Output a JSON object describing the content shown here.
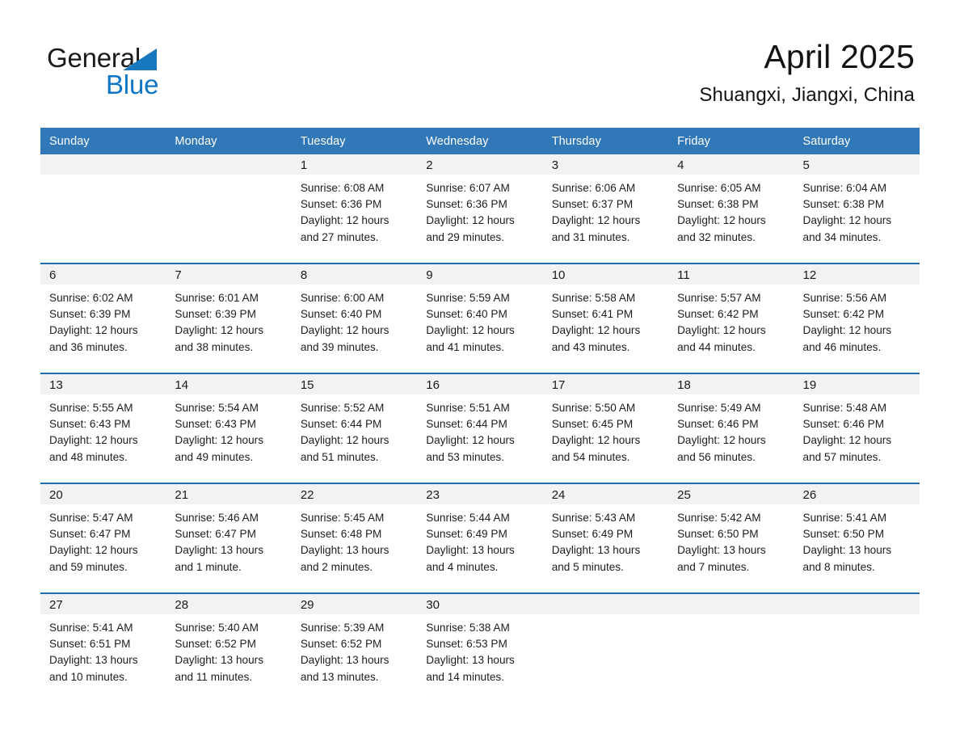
{
  "brand": {
    "name_part1": "General",
    "name_part2": "Blue",
    "triangle_color": "#1878be",
    "blue_color": "#0f76c4"
  },
  "header": {
    "month_title": "April 2025",
    "location": "Shuangxi, Jiangxi, China"
  },
  "theme": {
    "header_blue": "#3178b8",
    "separator_blue": "#1f6eb0",
    "daynum_band": "#f2f2f2",
    "text": "#1d1d1d"
  },
  "calendar": {
    "weekday_headers": [
      "Sunday",
      "Monday",
      "Tuesday",
      "Wednesday",
      "Thursday",
      "Friday",
      "Saturday"
    ],
    "weeks": [
      [
        {
          "day": "",
          "sunrise": "",
          "sunset": "",
          "daylight1": "",
          "daylight2": "",
          "empty": true
        },
        {
          "day": "",
          "sunrise": "",
          "sunset": "",
          "daylight1": "",
          "daylight2": "",
          "empty": true
        },
        {
          "day": "1",
          "sunrise": "Sunrise: 6:08 AM",
          "sunset": "Sunset: 6:36 PM",
          "daylight1": "Daylight: 12 hours",
          "daylight2": "and 27 minutes."
        },
        {
          "day": "2",
          "sunrise": "Sunrise: 6:07 AM",
          "sunset": "Sunset: 6:36 PM",
          "daylight1": "Daylight: 12 hours",
          "daylight2": "and 29 minutes."
        },
        {
          "day": "3",
          "sunrise": "Sunrise: 6:06 AM",
          "sunset": "Sunset: 6:37 PM",
          "daylight1": "Daylight: 12 hours",
          "daylight2": "and 31 minutes."
        },
        {
          "day": "4",
          "sunrise": "Sunrise: 6:05 AM",
          "sunset": "Sunset: 6:38 PM",
          "daylight1": "Daylight: 12 hours",
          "daylight2": "and 32 minutes."
        },
        {
          "day": "5",
          "sunrise": "Sunrise: 6:04 AM",
          "sunset": "Sunset: 6:38 PM",
          "daylight1": "Daylight: 12 hours",
          "daylight2": "and 34 minutes."
        }
      ],
      [
        {
          "day": "6",
          "sunrise": "Sunrise: 6:02 AM",
          "sunset": "Sunset: 6:39 PM",
          "daylight1": "Daylight: 12 hours",
          "daylight2": "and 36 minutes."
        },
        {
          "day": "7",
          "sunrise": "Sunrise: 6:01 AM",
          "sunset": "Sunset: 6:39 PM",
          "daylight1": "Daylight: 12 hours",
          "daylight2": "and 38 minutes."
        },
        {
          "day": "8",
          "sunrise": "Sunrise: 6:00 AM",
          "sunset": "Sunset: 6:40 PM",
          "daylight1": "Daylight: 12 hours",
          "daylight2": "and 39 minutes."
        },
        {
          "day": "9",
          "sunrise": "Sunrise: 5:59 AM",
          "sunset": "Sunset: 6:40 PM",
          "daylight1": "Daylight: 12 hours",
          "daylight2": "and 41 minutes."
        },
        {
          "day": "10",
          "sunrise": "Sunrise: 5:58 AM",
          "sunset": "Sunset: 6:41 PM",
          "daylight1": "Daylight: 12 hours",
          "daylight2": "and 43 minutes."
        },
        {
          "day": "11",
          "sunrise": "Sunrise: 5:57 AM",
          "sunset": "Sunset: 6:42 PM",
          "daylight1": "Daylight: 12 hours",
          "daylight2": "and 44 minutes."
        },
        {
          "day": "12",
          "sunrise": "Sunrise: 5:56 AM",
          "sunset": "Sunset: 6:42 PM",
          "daylight1": "Daylight: 12 hours",
          "daylight2": "and 46 minutes."
        }
      ],
      [
        {
          "day": "13",
          "sunrise": "Sunrise: 5:55 AM",
          "sunset": "Sunset: 6:43 PM",
          "daylight1": "Daylight: 12 hours",
          "daylight2": "and 48 minutes."
        },
        {
          "day": "14",
          "sunrise": "Sunrise: 5:54 AM",
          "sunset": "Sunset: 6:43 PM",
          "daylight1": "Daylight: 12 hours",
          "daylight2": "and 49 minutes."
        },
        {
          "day": "15",
          "sunrise": "Sunrise: 5:52 AM",
          "sunset": "Sunset: 6:44 PM",
          "daylight1": "Daylight: 12 hours",
          "daylight2": "and 51 minutes."
        },
        {
          "day": "16",
          "sunrise": "Sunrise: 5:51 AM",
          "sunset": "Sunset: 6:44 PM",
          "daylight1": "Daylight: 12 hours",
          "daylight2": "and 53 minutes."
        },
        {
          "day": "17",
          "sunrise": "Sunrise: 5:50 AM",
          "sunset": "Sunset: 6:45 PM",
          "daylight1": "Daylight: 12 hours",
          "daylight2": "and 54 minutes."
        },
        {
          "day": "18",
          "sunrise": "Sunrise: 5:49 AM",
          "sunset": "Sunset: 6:46 PM",
          "daylight1": "Daylight: 12 hours",
          "daylight2": "and 56 minutes."
        },
        {
          "day": "19",
          "sunrise": "Sunrise: 5:48 AM",
          "sunset": "Sunset: 6:46 PM",
          "daylight1": "Daylight: 12 hours",
          "daylight2": "and 57 minutes."
        }
      ],
      [
        {
          "day": "20",
          "sunrise": "Sunrise: 5:47 AM",
          "sunset": "Sunset: 6:47 PM",
          "daylight1": "Daylight: 12 hours",
          "daylight2": "and 59 minutes."
        },
        {
          "day": "21",
          "sunrise": "Sunrise: 5:46 AM",
          "sunset": "Sunset: 6:47 PM",
          "daylight1": "Daylight: 13 hours",
          "daylight2": "and 1 minute."
        },
        {
          "day": "22",
          "sunrise": "Sunrise: 5:45 AM",
          "sunset": "Sunset: 6:48 PM",
          "daylight1": "Daylight: 13 hours",
          "daylight2": "and 2 minutes."
        },
        {
          "day": "23",
          "sunrise": "Sunrise: 5:44 AM",
          "sunset": "Sunset: 6:49 PM",
          "daylight1": "Daylight: 13 hours",
          "daylight2": "and 4 minutes."
        },
        {
          "day": "24",
          "sunrise": "Sunrise: 5:43 AM",
          "sunset": "Sunset: 6:49 PM",
          "daylight1": "Daylight: 13 hours",
          "daylight2": "and 5 minutes."
        },
        {
          "day": "25",
          "sunrise": "Sunrise: 5:42 AM",
          "sunset": "Sunset: 6:50 PM",
          "daylight1": "Daylight: 13 hours",
          "daylight2": "and 7 minutes."
        },
        {
          "day": "26",
          "sunrise": "Sunrise: 5:41 AM",
          "sunset": "Sunset: 6:50 PM",
          "daylight1": "Daylight: 13 hours",
          "daylight2": "and 8 minutes."
        }
      ],
      [
        {
          "day": "27",
          "sunrise": "Sunrise: 5:41 AM",
          "sunset": "Sunset: 6:51 PM",
          "daylight1": "Daylight: 13 hours",
          "daylight2": "and 10 minutes."
        },
        {
          "day": "28",
          "sunrise": "Sunrise: 5:40 AM",
          "sunset": "Sunset: 6:52 PM",
          "daylight1": "Daylight: 13 hours",
          "daylight2": "and 11 minutes."
        },
        {
          "day": "29",
          "sunrise": "Sunrise: 5:39 AM",
          "sunset": "Sunset: 6:52 PM",
          "daylight1": "Daylight: 13 hours",
          "daylight2": "and 13 minutes."
        },
        {
          "day": "30",
          "sunrise": "Sunrise: 5:38 AM",
          "sunset": "Sunset: 6:53 PM",
          "daylight1": "Daylight: 13 hours",
          "daylight2": "and 14 minutes."
        },
        {
          "day": "",
          "sunrise": "",
          "sunset": "",
          "daylight1": "",
          "daylight2": "",
          "empty": true
        },
        {
          "day": "",
          "sunrise": "",
          "sunset": "",
          "daylight1": "",
          "daylight2": "",
          "empty": true
        },
        {
          "day": "",
          "sunrise": "",
          "sunset": "",
          "daylight1": "",
          "daylight2": "",
          "empty": true
        }
      ]
    ]
  }
}
